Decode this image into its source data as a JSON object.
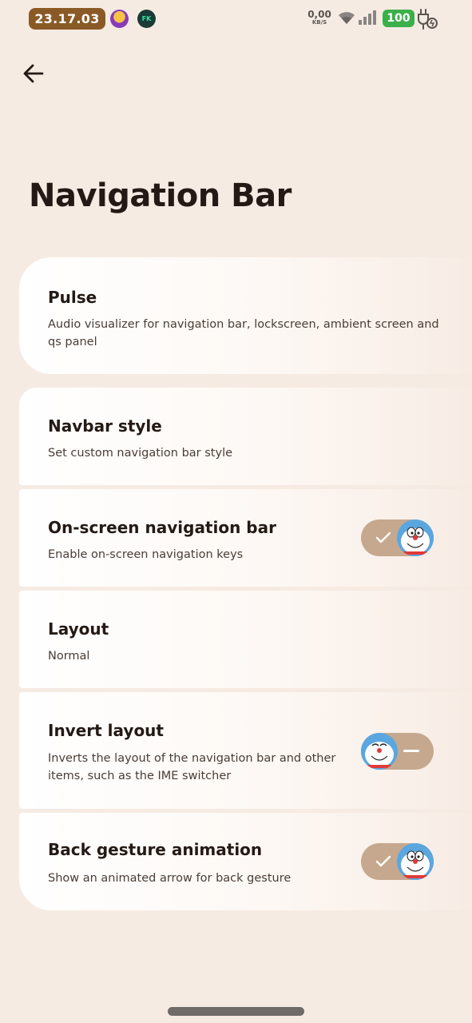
{
  "status_bar": {
    "time": "23.17.03",
    "app_icon_2_label": "FK",
    "net_speed_value": "0,00",
    "net_speed_unit": "KB/S",
    "battery_level": "100",
    "battery_color": "#3bb04a"
  },
  "page": {
    "title": "Navigation Bar"
  },
  "settings": [
    {
      "title": "Pulse",
      "summary": "Audio visualizer for navigation bar, lockscreen, ambient screen and qs panel"
    },
    {
      "title": "Navbar style",
      "summary": "Set custom navigation bar style"
    },
    {
      "title": "On-screen navigation bar",
      "summary": "Enable on-screen navigation keys",
      "toggle": true
    },
    {
      "title": "Layout",
      "summary": "Normal"
    },
    {
      "title": "Invert layout",
      "summary": "Inverts the layout of the navigation bar and other items, such as the IME switcher",
      "toggle": false
    },
    {
      "title": "Back gesture animation",
      "summary": "Show an animated arrow for back gesture",
      "toggle": true
    }
  ],
  "icons": {
    "back": "back-arrow-icon",
    "toggle_knob": "doraemon-face-icon",
    "toggle_on_mark": "check-icon",
    "toggle_off_mark": "minus-icon"
  },
  "colors": {
    "background": "#f6ebe3",
    "accent": "#c6a88e",
    "clock_chip": "#8a5a26"
  }
}
